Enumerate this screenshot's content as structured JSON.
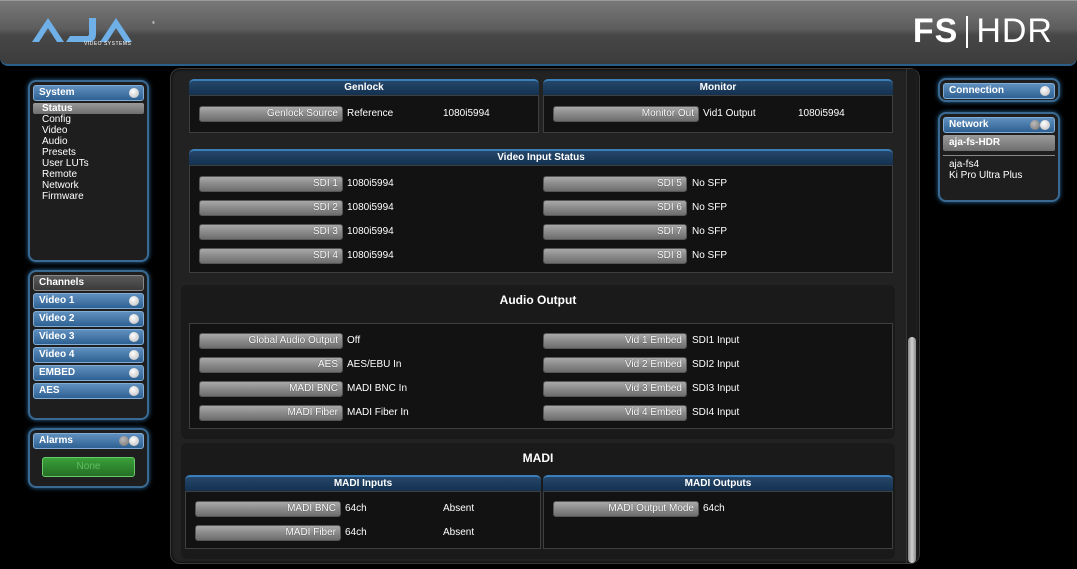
{
  "header": {
    "logo_text": "AJA",
    "logo_subtext": "VIDEO SYSTEMS",
    "product_fs": "FS",
    "product_hdr": "HDR"
  },
  "system": {
    "title": "System",
    "items": [
      {
        "label": "Status",
        "active": true
      },
      {
        "label": "Config"
      },
      {
        "label": "Video"
      },
      {
        "label": "Audio"
      },
      {
        "label": "Presets"
      },
      {
        "label": "User LUTs"
      },
      {
        "label": "Remote"
      },
      {
        "label": "Network"
      },
      {
        "label": "Firmware"
      }
    ]
  },
  "channels": {
    "title": "Channels",
    "items": [
      "Video 1",
      "Video 2",
      "Video 3",
      "Video 4",
      "EMBED",
      "AES"
    ]
  },
  "alarms": {
    "title": "Alarms",
    "status": "None",
    "status_color": "#2f8a2f"
  },
  "connection": {
    "title": "Connection"
  },
  "network": {
    "title": "Network",
    "current": "aja-fs-HDR",
    "devices": [
      "aja-fs4",
      "Ki Pro Ultra Plus"
    ]
  },
  "genlock": {
    "title": "Genlock",
    "button": "Genlock Source",
    "value": "Reference",
    "format": "1080i5994"
  },
  "monitor": {
    "title": "Monitor",
    "button": "Monitor Out",
    "value": "Vid1 Output",
    "format": "1080i5994"
  },
  "video_input_status": {
    "title": "Video Input Status",
    "left": [
      {
        "label": "SDI 1",
        "value": "1080i5994"
      },
      {
        "label": "SDI 2",
        "value": "1080i5994"
      },
      {
        "label": "SDI 3",
        "value": "1080i5994"
      },
      {
        "label": "SDI 4",
        "value": "1080i5994"
      }
    ],
    "right": [
      {
        "label": "SDI 5",
        "value": "No SFP"
      },
      {
        "label": "SDI 6",
        "value": "No SFP"
      },
      {
        "label": "SDI 7",
        "value": "No SFP"
      },
      {
        "label": "SDI 8",
        "value": "No SFP"
      }
    ]
  },
  "audio_output": {
    "title": "Audio Output",
    "left": [
      {
        "label": "Global Audio Output",
        "value": "Off"
      },
      {
        "label": "AES",
        "value": "AES/EBU In"
      },
      {
        "label": "MADI BNC",
        "value": "MADI BNC In"
      },
      {
        "label": "MADI Fiber",
        "value": "MADI Fiber In"
      }
    ],
    "right": [
      {
        "label": "Vid 1 Embed",
        "value": "SDI1 Input"
      },
      {
        "label": "Vid 2 Embed",
        "value": "SDI2 Input"
      },
      {
        "label": "Vid 3 Embed",
        "value": "SDI3 Input"
      },
      {
        "label": "Vid 4 Embed",
        "value": "SDI4 Input"
      }
    ]
  },
  "madi": {
    "title": "MADI",
    "inputs_title": "MADI Inputs",
    "outputs_title": "MADI Outputs",
    "inputs": [
      {
        "label": "MADI BNC",
        "channels": "64ch",
        "state": "Absent"
      },
      {
        "label": "MADI Fiber",
        "channels": "64ch",
        "state": "Absent"
      }
    ],
    "outputs": [
      {
        "label": "MADI Output Mode",
        "value": "64ch"
      }
    ]
  }
}
